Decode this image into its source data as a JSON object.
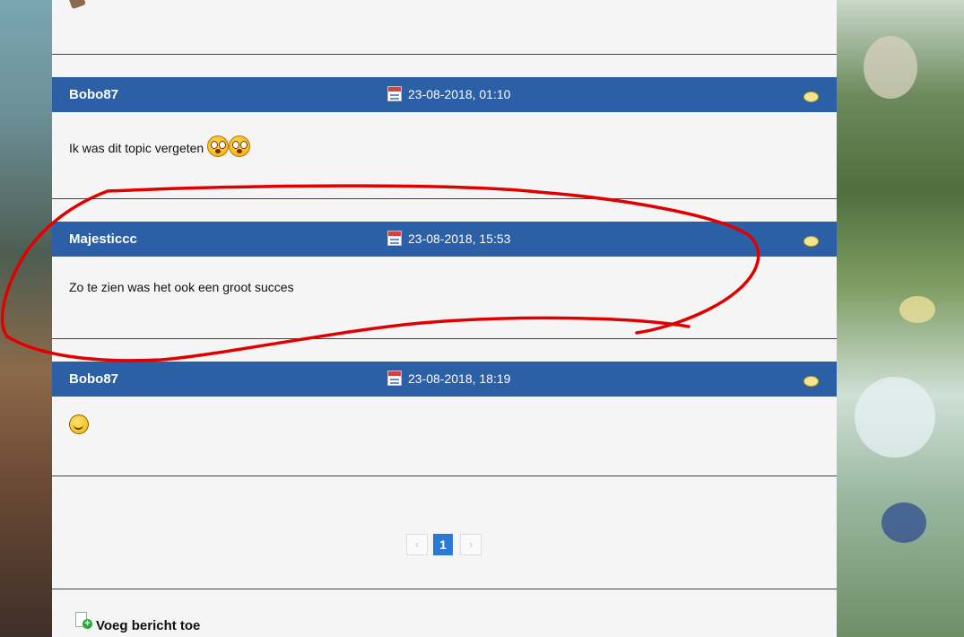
{
  "posts": [
    {
      "author": "Bobo87",
      "date": "23-08-2018, 01:10",
      "body": "Ik was dit topic vergeten",
      "emoji": [
        "shocked-smiley",
        "shocked-smiley"
      ]
    },
    {
      "author": "Majesticcc",
      "date": "23-08-2018, 15:53",
      "body": "Zo te zien was het ook een groot succes",
      "emoji": []
    },
    {
      "author": "Bobo87",
      "date": "23-08-2018, 18:19",
      "body": "",
      "emoji": [
        "laughing-smiley"
      ]
    }
  ],
  "pagination": {
    "prev": "‹",
    "current": "1",
    "next": "›"
  },
  "actions": {
    "add_post": "Voeg bericht toe"
  },
  "colors": {
    "post_header": "#2b5fa6",
    "pagination_active": "#2b79d2",
    "annotation": "#e00000"
  }
}
